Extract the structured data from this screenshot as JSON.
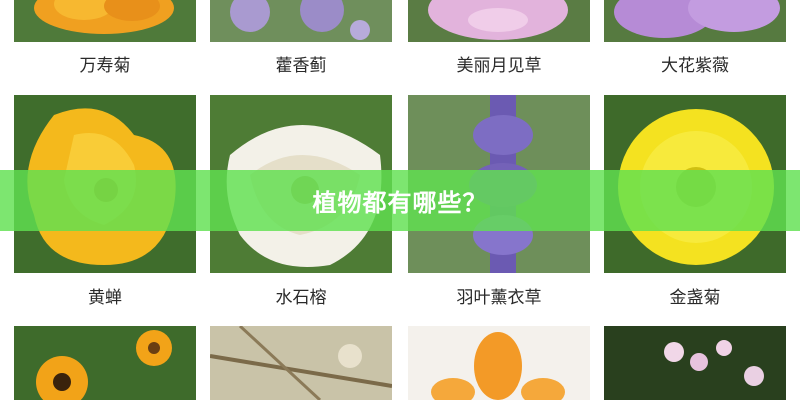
{
  "banner": {
    "title": "植物都有哪些？"
  },
  "rows": [
    {
      "captions": [
        "万寿菊",
        "藿香蓟",
        "美丽月见草",
        "大花紫薇"
      ]
    },
    {
      "captions": [
        "黄蝉",
        "水石榕",
        "羽叶薰衣草",
        "金盏菊"
      ]
    }
  ],
  "colors": {
    "banner": "#60e050",
    "caption_text": "#2a2a2a"
  }
}
